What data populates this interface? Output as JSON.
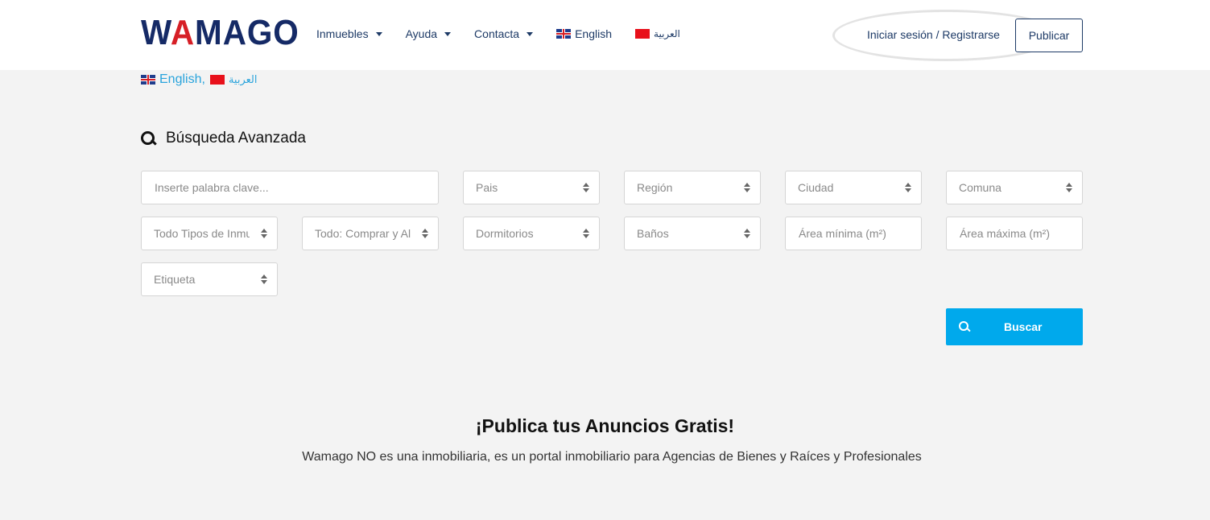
{
  "header": {
    "logo_text_1": "W",
    "logo_text_a": "A",
    "logo_text_2": "MAGO",
    "nav": {
      "inmuebles": "Inmuebles",
      "ayuda": "Ayuda",
      "contacta": "Contacta",
      "english": "English",
      "arabic": "العربية"
    },
    "login": "Iniciar sesión / Registrarse",
    "publicar": "Publicar"
  },
  "lang_bar": {
    "english": "English",
    "separator": ",",
    "arabic": "العربية"
  },
  "search": {
    "title": "Búsqueda Avanzada",
    "keyword_placeholder": "Inserte palabra clave...",
    "pais": "Pais",
    "region": "Región",
    "ciudad": "Ciudad",
    "comuna": "Comuna",
    "tipos": "Todo Tipos de Inmuebles",
    "comprar": "Todo: Comprar y Alquilar",
    "dormitorios": "Dormitorios",
    "banos": "Baños",
    "area_min_placeholder": "Área mínima (m²)",
    "area_max_placeholder": "Área máxima (m²)",
    "etiqueta": "Etiqueta",
    "button": "Buscar"
  },
  "promo": {
    "title": "¡Publica tus Anuncios Gratis!",
    "subtitle": "Wamago NO es una inmobiliaria, es un portal inmobiliario para Agencias de Bienes y Raíces y Profesionales"
  },
  "colors": {
    "brand_navy": "#152a66",
    "brand_red": "#d61f26",
    "accent_blue": "#00a9ec",
    "link_blue": "#2aa4dc"
  }
}
